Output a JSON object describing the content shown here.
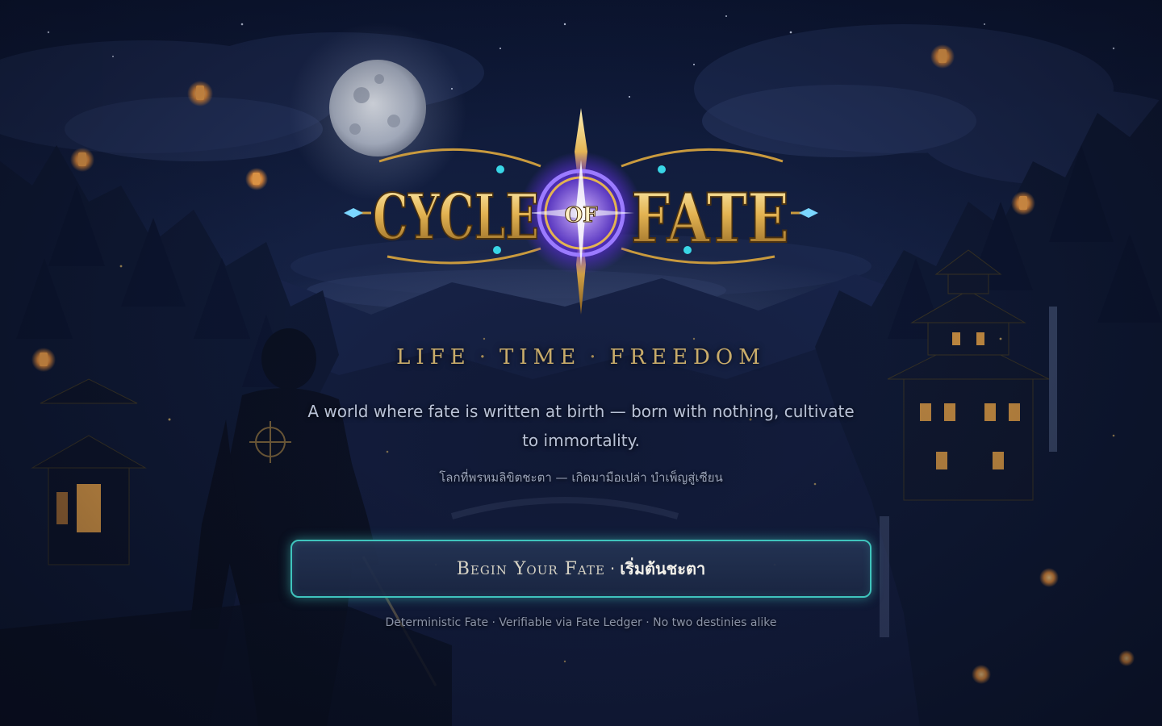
{
  "logo": {
    "word1": "CYCLE",
    "word2": "OF",
    "word3": "FATE"
  },
  "tagline": {
    "part1": "LIFE",
    "part2": "TIME",
    "part3": "FREEDOM",
    "separator": "·"
  },
  "description": {
    "english": "A world where fate is written at birth — born with nothing, cultivate to immortality.",
    "thai": "โลกที่พรหมลิขิตชะตา — เกิดมามือเปล่า บำเพ็ญสู่เซียน"
  },
  "cta": {
    "english": "Begin Your Fate",
    "separator": "·",
    "thai": "เริ่มต้นชะตา"
  },
  "footnote": "Deterministic Fate · Verifiable via Fate Ledger · No two destinies alike",
  "colors": {
    "gold": "#c9ac6a",
    "accent_teal": "#3fc4bd",
    "button_bg": "#243454",
    "night_sky": "#0b1226",
    "arcane_purple": "#8a5cff"
  }
}
